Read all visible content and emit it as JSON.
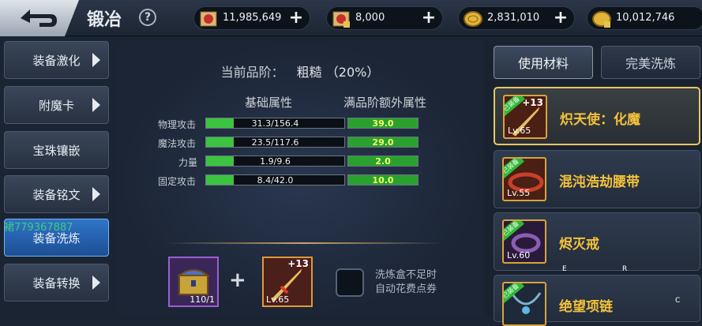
{
  "header": {
    "title": "锻冶",
    "help": "?",
    "resources": [
      {
        "icon": "scroll-red-icon",
        "value": "11,985,649"
      },
      {
        "icon": "scroll-lock-icon",
        "value": "8,000"
      },
      {
        "icon": "gold-coin-icon",
        "value": "2,831,010"
      },
      {
        "icon": "gold-coin-lock-icon",
        "value": "10,012,746"
      }
    ],
    "plus": "+"
  },
  "sidebar": {
    "items": [
      {
        "label": "装备激化"
      },
      {
        "label": "附魔卡"
      },
      {
        "label": "宝珠镶嵌"
      },
      {
        "label": "装备铭文"
      },
      {
        "label": "装备洗炼"
      },
      {
        "label": "装备转换"
      }
    ],
    "watermark": "裙779367887"
  },
  "main": {
    "grade_label": "当前品阶：",
    "grade_value": "粗糙  （20%）",
    "col_base": "基础属性",
    "col_bonus": "满品阶额外属性",
    "rows": [
      {
        "label": "物理攻击",
        "base": "31.3/156.4",
        "fill": 0.2,
        "bonus": "39.0"
      },
      {
        "label": "魔法攻击",
        "base": "23.5/117.6",
        "fill": 0.2,
        "bonus": "29.0"
      },
      {
        "label": "力量",
        "base": "1.9/9.6",
        "fill": 0.2,
        "bonus": "2.0"
      },
      {
        "label": "固定攻击",
        "base": "8.4/42.0",
        "fill": 0.2,
        "bonus": "10.0"
      }
    ],
    "slot1_count": "110/1",
    "slot2_plus": "+13",
    "slot2_lv": "Lv.65",
    "plus_sign": "+",
    "checkbox_text_1": "洗炼盒不足时",
    "checkbox_text_2": "自动花费点券"
  },
  "right_panel": {
    "tab_active": "使用材料",
    "tab_inactive": "完美洗炼",
    "materials": [
      {
        "tag": "已装备",
        "lv": "Lv.65",
        "plus": "+13",
        "name": "炽天使：化魔"
      },
      {
        "tag": "已装备",
        "lv": "Lv.55",
        "plus": "",
        "name": "混沌浩劫腰带"
      },
      {
        "tag": "已装备",
        "lv": "Lv.60",
        "plus": "",
        "name": "烬灭戒"
      },
      {
        "tag": "已装备",
        "lv": "",
        "plus": "",
        "name": "绝望项链"
      }
    ]
  },
  "key_hints": [
    "E",
    "R",
    "C"
  ],
  "colors": {
    "accent_gold": "#f4c23a",
    "bar_green": "#3bc43f",
    "bonus_text": "#f2ff6a"
  }
}
